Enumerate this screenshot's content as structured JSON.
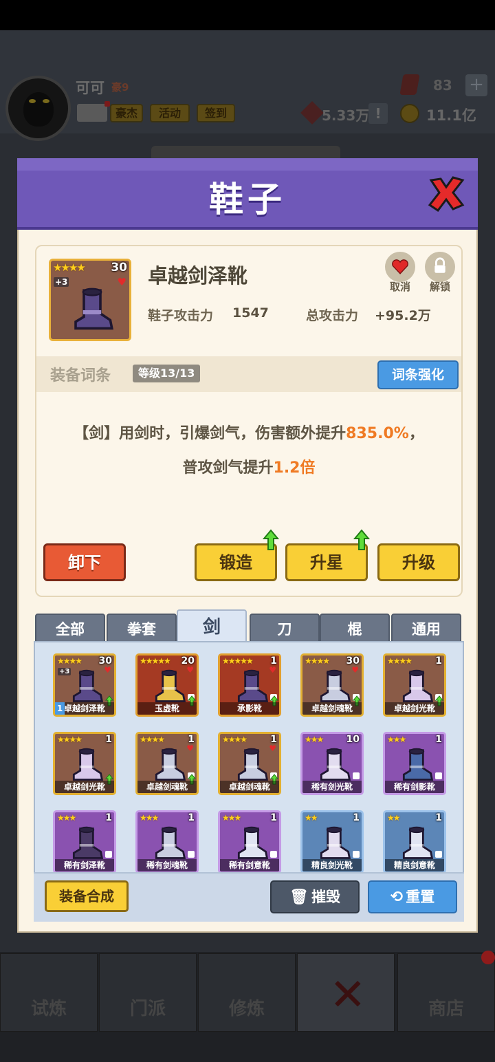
{
  "player": {
    "name": "可可",
    "vip": "豪9",
    "buttons": [
      "豪杰",
      "活动",
      "签到"
    ],
    "gems": "83",
    "copper": "5.33万",
    "coins": "11.1亿"
  },
  "nav": [
    {
      "label": "试炼",
      "icon": "ninja-icon"
    },
    {
      "label": "门派",
      "icon": "temple-icon"
    },
    {
      "label": "修炼",
      "icon": "book-icon"
    },
    {
      "label": "",
      "icon": "close-icon"
    },
    {
      "label": "商店",
      "icon": "shop-icon"
    }
  ],
  "modal": {
    "title": "鞋子",
    "item": {
      "name": "卓越剑泽靴",
      "stars": "★★★★",
      "level": "30",
      "plus": "+3",
      "attack_label": "鞋子攻击力",
      "attack_value": "1547",
      "total_label": "总攻击力",
      "total_value": "+95.2万"
    },
    "mini": {
      "cancel": "取消",
      "unlock": "解锁"
    },
    "affix": {
      "title": "装备词条",
      "level": "等级13/13",
      "enhance_button": "词条强化",
      "line1_prefix": "【剑】用剑时，引爆剑气，伤害额外提升",
      "line1_value": "835.0%",
      "line1_suffix": "，",
      "line2_prefix": "普攻剑气提升",
      "line2_value": "1.2倍"
    },
    "actions": {
      "unequip": "卸下",
      "forge": "锻造",
      "star_up": "升星",
      "upgrade": "升级"
    },
    "tabs": [
      "全部",
      "拳套",
      "剑",
      "刀",
      "棍",
      "通用"
    ],
    "active_tab": "剑",
    "items": [
      {
        "name": "卓越剑泽靴",
        "stars": "★★★★",
        "level": "30",
        "plus": "+3",
        "rarity": "gold",
        "boot": "#5a4a8a",
        "heart": true,
        "arrow": true,
        "equipped": "1"
      },
      {
        "name": "玉虚靴",
        "stars": "★★★★★",
        "level": "20",
        "rarity": "red",
        "boot": "#e8c24a",
        "heart": true,
        "arrow": true,
        "lock": true
      },
      {
        "name": "承影靴",
        "stars": "★★★★★",
        "level": "1",
        "rarity": "red",
        "boot": "#5a4a8a",
        "heart": true,
        "arrow": true,
        "lock": true
      },
      {
        "name": "卓越剑魂靴",
        "stars": "★★★★",
        "level": "30",
        "rarity": "gold",
        "boot": "#c8cde0",
        "heart": true,
        "arrow": true,
        "lock": true
      },
      {
        "name": "卓越剑光靴",
        "stars": "★★★★",
        "level": "1",
        "rarity": "gold",
        "boot": "#d8c8ea",
        "arrow": true,
        "lock": true
      },
      {
        "name": "卓越剑光靴",
        "stars": "★★★★",
        "level": "1",
        "rarity": "gold",
        "boot": "#d8c8ea",
        "arrow": true
      },
      {
        "name": "卓越剑魂靴",
        "stars": "★★★★",
        "level": "1",
        "rarity": "gold",
        "boot": "#c8cde0",
        "heart": true,
        "arrow": true,
        "lock": true
      },
      {
        "name": "卓越剑魂靴",
        "stars": "★★★★",
        "level": "1",
        "rarity": "gold",
        "boot": "#c8cde0",
        "heart": true,
        "arrow": true,
        "lock": true
      },
      {
        "name": "稀有剑光靴",
        "stars": "★★★",
        "level": "10",
        "rarity": "purple",
        "boot": "#e2dcef",
        "lock": true
      },
      {
        "name": "稀有剑影靴",
        "stars": "★★★",
        "level": "1",
        "rarity": "purple",
        "boot": "#4a6aa8",
        "lock": true
      },
      {
        "name": "稀有剑泽靴",
        "stars": "★★★",
        "level": "1",
        "rarity": "purple",
        "boot": "#4a3a66",
        "lock": true
      },
      {
        "name": "稀有剑魂靴",
        "stars": "★★★",
        "level": "1",
        "rarity": "purple",
        "boot": "#c8cde0",
        "lock": true
      },
      {
        "name": "稀有剑意靴",
        "stars": "★★★",
        "level": "1",
        "rarity": "purple",
        "boot": "#e0e4f2",
        "lock": true
      },
      {
        "name": "精良剑光靴",
        "stars": "★★",
        "level": "1",
        "rarity": "blue",
        "boot": "#e2dcef",
        "lock": true
      },
      {
        "name": "精良剑意靴",
        "stars": "★★",
        "level": "1",
        "rarity": "blue",
        "boot": "#e0e4f2",
        "lock": true
      }
    ],
    "bottom": {
      "merge": "装备合成",
      "destroy": "摧毁",
      "reset": "重置"
    }
  },
  "colors": {
    "accent_purple": "#6f58b8",
    "highlight": "#ef7a23",
    "blue_button": "#4a9ae3",
    "yellow_button": "#f9cf36",
    "red_button": "#e85a35"
  }
}
